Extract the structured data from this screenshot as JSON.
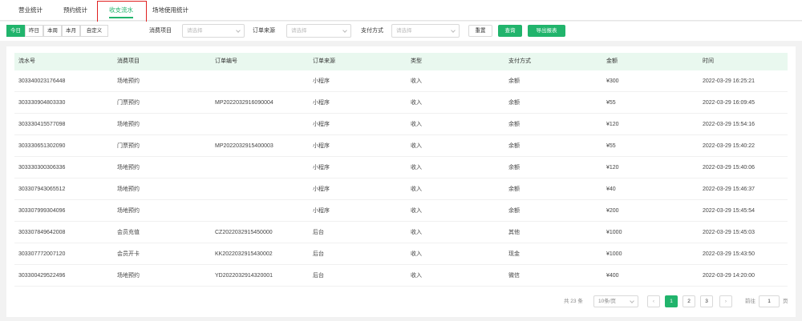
{
  "tabs": [
    {
      "label": "营业统计"
    },
    {
      "label": "预约统计"
    },
    {
      "label": "收支流水"
    },
    {
      "label": "场地使用统计"
    }
  ],
  "filters": {
    "periods": [
      "今日",
      "昨日",
      "本周",
      "本月",
      "自定义"
    ],
    "fields": [
      {
        "label": "消费项目",
        "placeholder": "请选择"
      },
      {
        "label": "订单来源",
        "placeholder": "请选择"
      },
      {
        "label": "支付方式",
        "placeholder": "请选择"
      }
    ],
    "reset_label": "重置",
    "query_label": "查询",
    "export_label": "导出报表"
  },
  "table": {
    "columns": [
      "流水号",
      "消费项目",
      "订单编号",
      "订单来源",
      "类型",
      "支付方式",
      "金额",
      "时间"
    ],
    "rows": [
      [
        "303340023176448",
        "场地预约",
        "",
        "小程序",
        "收入",
        "余额",
        "¥300",
        "2022-03-29 16:25:21"
      ],
      [
        "303330904803330",
        "门票预约",
        "MP2022032916090004",
        "小程序",
        "收入",
        "余额",
        "¥55",
        "2022-03-29 16:09:45"
      ],
      [
        "303330415577098",
        "场地预约",
        "",
        "小程序",
        "收入",
        "余额",
        "¥120",
        "2022-03-29 15:54:16"
      ],
      [
        "303330651302090",
        "门票预约",
        "MP2022032915400003",
        "小程序",
        "收入",
        "余额",
        "¥55",
        "2022-03-29 15:40:22"
      ],
      [
        "303330300306336",
        "场地预约",
        "",
        "小程序",
        "收入",
        "余额",
        "¥120",
        "2022-03-29 15:40:06"
      ],
      [
        "303307943065512",
        "场地预约",
        "",
        "小程序",
        "收入",
        "余额",
        "¥40",
        "2022-03-29 15:46:37"
      ],
      [
        "303307999304096",
        "场地预约",
        "",
        "小程序",
        "收入",
        "余额",
        "¥200",
        "2022-03-29 15:45:54"
      ],
      [
        "303307849642008",
        "会员充值",
        "CZ2022032915450000",
        "后台",
        "收入",
        "其他",
        "¥1000",
        "2022-03-29 15:45:03"
      ],
      [
        "303307772007120",
        "会员开卡",
        "KK2022032915430002",
        "后台",
        "收入",
        "现金",
        "¥1000",
        "2022-03-29 15:43:50"
      ],
      [
        "303300429522496",
        "场地预约",
        "YD2022032914320001",
        "后台",
        "收入",
        "微信",
        "¥400",
        "2022-03-29 14:20:00"
      ]
    ]
  },
  "pagination": {
    "total_text": "共 23 条",
    "page_size": "10条/页",
    "prev_symbol": "‹",
    "next_symbol": "›",
    "pages": [
      "1",
      "2",
      "3"
    ],
    "goto_prefix": "前往",
    "goto_value": "1",
    "goto_suffix": "页"
  }
}
